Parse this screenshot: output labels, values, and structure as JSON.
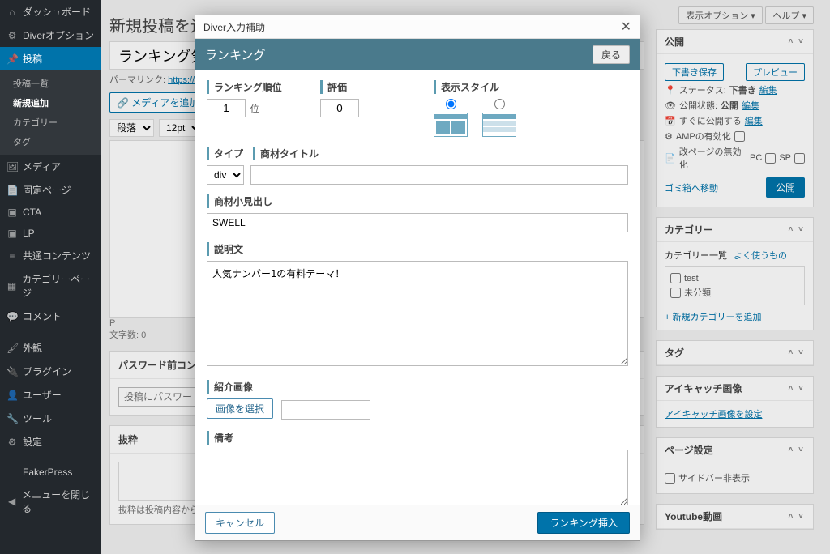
{
  "sidebar": {
    "items": [
      {
        "icon": "⌂",
        "label": "ダッシュボード"
      },
      {
        "icon": "⚙",
        "label": "Diverオプション"
      },
      {
        "icon": "📌",
        "label": "投稿",
        "active": true
      },
      {
        "icon": "🖼",
        "label": "メディア"
      },
      {
        "icon": "📄",
        "label": "固定ページ"
      },
      {
        "icon": "▣",
        "label": "CTA"
      },
      {
        "icon": "▣",
        "label": "LP"
      },
      {
        "icon": "≡",
        "label": "共通コンテンツ"
      },
      {
        "icon": "▦",
        "label": "カテゴリーページ"
      },
      {
        "icon": "💬",
        "label": "コメント"
      },
      {
        "icon": "🖌",
        "label": "外観"
      },
      {
        "icon": "🔌",
        "label": "プラグイン"
      },
      {
        "icon": "👤",
        "label": "ユーザー"
      },
      {
        "icon": "🔧",
        "label": "ツール"
      },
      {
        "icon": "⚙",
        "label": "設定"
      },
      {
        "icon": "",
        "label": "FakerPress"
      },
      {
        "icon": "◀",
        "label": "メニューを閉じる"
      }
    ],
    "sub": [
      "投稿一覧",
      "新規追加",
      "カテゴリー",
      "タグ"
    ],
    "sub_active": "新規追加"
  },
  "main": {
    "page_heading": "新規投稿を追",
    "title_input": "ランキング気",
    "permalink_label": "パーマリンク:",
    "permalink_url": "https://",
    "media_btn": "メディアを追加",
    "para_select": "段落",
    "font_select": "12pt",
    "status_p": "P",
    "charcount": "文字数: 0",
    "pwd_box_title": "パスワード前コンテ…",
    "pwd_placeholder": "投稿にパスワード",
    "excerpt_title": "抜粋",
    "excerpt_note": "抜粋は投稿内容から"
  },
  "toptabs": {
    "screen_options": "表示オプション ▾",
    "help": "ヘルプ ▾"
  },
  "publish": {
    "title": "公開",
    "save_draft": "下書き保存",
    "preview": "プレビュー",
    "status_label": "ステータス:",
    "status_value": "下書き",
    "edit": "編集",
    "visibility_label": "公開状態:",
    "visibility_value": "公開",
    "schedule_label": "すぐに公開する",
    "amp_label": "AMPの有効化",
    "pageswap_label": "改ページの無効化",
    "pc": "PC",
    "sp": "SP",
    "trash": "ゴミ箱へ移動",
    "publish_btn": "公開"
  },
  "categories": {
    "title": "カテゴリー",
    "tab1": "カテゴリー一覧",
    "tab2": "よく使うもの",
    "items": [
      "test",
      "未分類"
    ],
    "add": "+ 新規カテゴリーを追加"
  },
  "tags": {
    "title": "タグ"
  },
  "eyecatch": {
    "title": "アイキャッチ画像",
    "link": "アイキャッチ画像を設定"
  },
  "pageset": {
    "title": "ページ設定",
    "opt": "サイドバー非表示"
  },
  "youtube": {
    "title": "Youtube動画"
  },
  "dialog": {
    "titlebar": "Diver入力補助",
    "header": "ランキング",
    "back": "戻る",
    "rank_label": "ランキング順位",
    "rank_value": "1",
    "rank_suffix": "位",
    "rating_label": "評価",
    "rating_value": "0",
    "style_label": "表示スタイル",
    "type_label": "タイプ",
    "item_title_label": "商材タイトル",
    "type_value": "div",
    "item_title_value": "",
    "subhead_label": "商材小見出し",
    "subhead_value": "SWELL",
    "desc_label": "説明文",
    "desc_value": "人気ナンバー1の有料テーマ！",
    "image_label": "紹介画像",
    "image_btn": "画像を選択",
    "note_label": "備考",
    "note_value": "",
    "cancel": "キャンセル",
    "insert": "ランキング挿入"
  }
}
